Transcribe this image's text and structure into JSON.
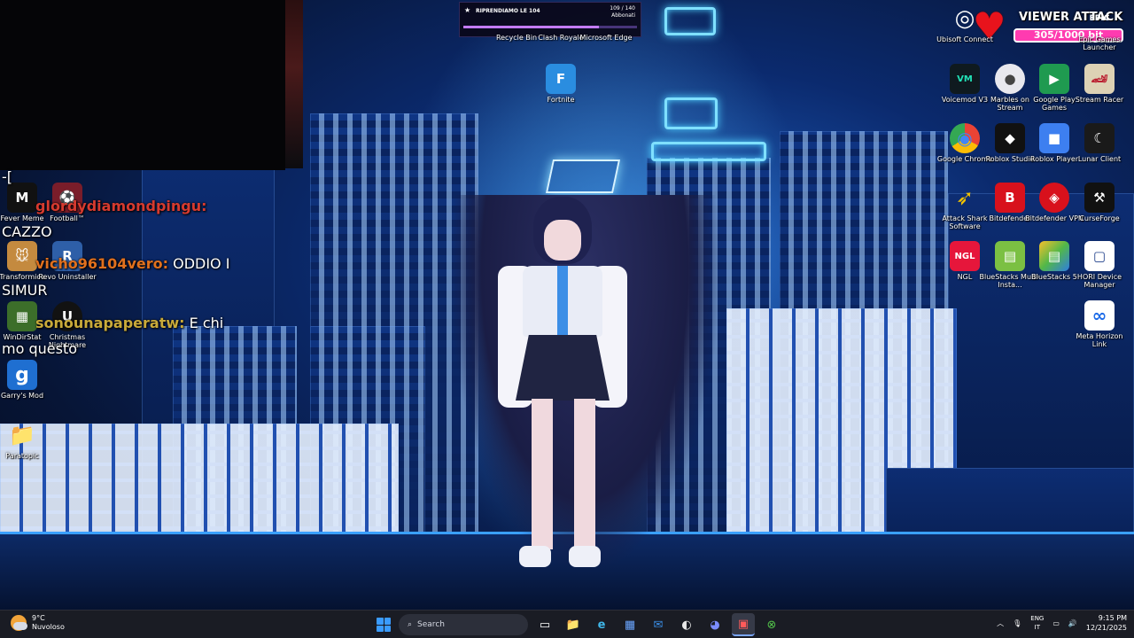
{
  "goal_overlay": {
    "title": "RIPRENDIAMO LE 104",
    "count": "109 / 140",
    "label": "Abbonati",
    "progress": 0.78
  },
  "viewer_attack": {
    "title": "VIEWER ATTACK",
    "value": "305/1000 bit"
  },
  "chat": {
    "lines": [
      {
        "text": "-[",
        "color": "#ffffff"
      },
      {
        "user": "glordydiamondpingu:",
        "user_color": "#d63a2f",
        "text": "",
        "color": "#ffffff"
      },
      {
        "text": "CAZZO",
        "color": "#ffffff"
      },
      {
        "user": "vicho96104vero:",
        "user_color": "#e0701e",
        "text": " ODDIO I",
        "color": "#ffffff"
      },
      {
        "text": "SIMUR",
        "color": "#ffffff"
      },
      {
        "user": "sonounapaperatw:",
        "user_color": "#c9aa3a",
        "text": " E chi",
        "color": "#ffffff"
      },
      {
        "text": "mo questo",
        "color": "#ffffff"
      }
    ]
  },
  "desktop": {
    "top_icons": [
      {
        "label": "Recycle Bin"
      },
      {
        "label": "Clash Royale"
      },
      {
        "label": "Microsoft Edge"
      }
    ],
    "fortnite": {
      "label": "Fortnite",
      "glyph": "F"
    },
    "left_icons": [
      {
        "label": "Fever Meme",
        "glyph": "M"
      },
      {
        "label": "Football™",
        "glyph": "⚽"
      },
      {
        "label": "Transformice",
        "glyph": "🐭"
      },
      {
        "label": "Revo Uninstaller",
        "glyph": "R"
      },
      {
        "label": "WinDirStat",
        "glyph": "▦"
      },
      {
        "label": "Christmas Nightmare",
        "glyph": "U"
      },
      {
        "label": "Garry's Mod",
        "glyph": "g"
      },
      {
        "label": "Paratopic",
        "glyph": "📁"
      }
    ],
    "right_icons": [
      {
        "label": "Ubisoft Connect",
        "glyph": "◎"
      },
      {
        "label": "Epic Games Launcher",
        "glyph": "EPIC"
      },
      {
        "label": "Voicemod V3",
        "glyph": "VM"
      },
      {
        "label": "Marbles on Stream",
        "glyph": "●"
      },
      {
        "label": "Google Play Games",
        "glyph": "▶"
      },
      {
        "label": "Stream Racer",
        "glyph": "🏎"
      },
      {
        "label": "Google Chrome",
        "glyph": "◉"
      },
      {
        "label": "Roblox Studio",
        "glyph": "◆"
      },
      {
        "label": "Roblox Player",
        "glyph": "■"
      },
      {
        "label": "Lunar Client",
        "glyph": "☾"
      },
      {
        "label": "Attack Shark Software",
        "glyph": "➶"
      },
      {
        "label": "Bitdefender",
        "glyph": "B"
      },
      {
        "label": "Bitdefender VPN",
        "glyph": "◈"
      },
      {
        "label": "CurseForge",
        "glyph": "⚒"
      },
      {
        "label": "NGL",
        "glyph": "NGL"
      },
      {
        "label": "BlueStacks Multi-Insta...",
        "glyph": "▤"
      },
      {
        "label": "BlueStacks 5",
        "glyph": "▤"
      },
      {
        "label": "HORI Device Manager",
        "glyph": "▢"
      },
      {
        "label": "Meta Horizon Link",
        "glyph": "∞"
      }
    ]
  },
  "taskbar": {
    "weather": {
      "temp": "9°C",
      "desc": "Nuvoloso"
    },
    "search_placeholder": "Search",
    "language": {
      "line1": "ENG",
      "line2": "IT"
    },
    "time": "9:15 PM",
    "date": "12/21/2025",
    "apps": [
      {
        "name": "task-view-icon",
        "glyph": "▭"
      },
      {
        "name": "file-explorer-icon",
        "glyph": "📁"
      },
      {
        "name": "edge-icon",
        "glyph": "e"
      },
      {
        "name": "store-icon",
        "glyph": "▦"
      },
      {
        "name": "outlook-icon",
        "glyph": "✉"
      },
      {
        "name": "obs-icon",
        "glyph": "◐"
      },
      {
        "name": "discord-icon",
        "glyph": "◕"
      },
      {
        "name": "streaming-app-icon",
        "glyph": "▣"
      },
      {
        "name": "xbox-icon",
        "glyph": "⊗"
      }
    ]
  },
  "colors": {
    "accent": "#3a9bff",
    "pink_bar": "#ff3bb0",
    "goal_fill": "#c37bff"
  }
}
